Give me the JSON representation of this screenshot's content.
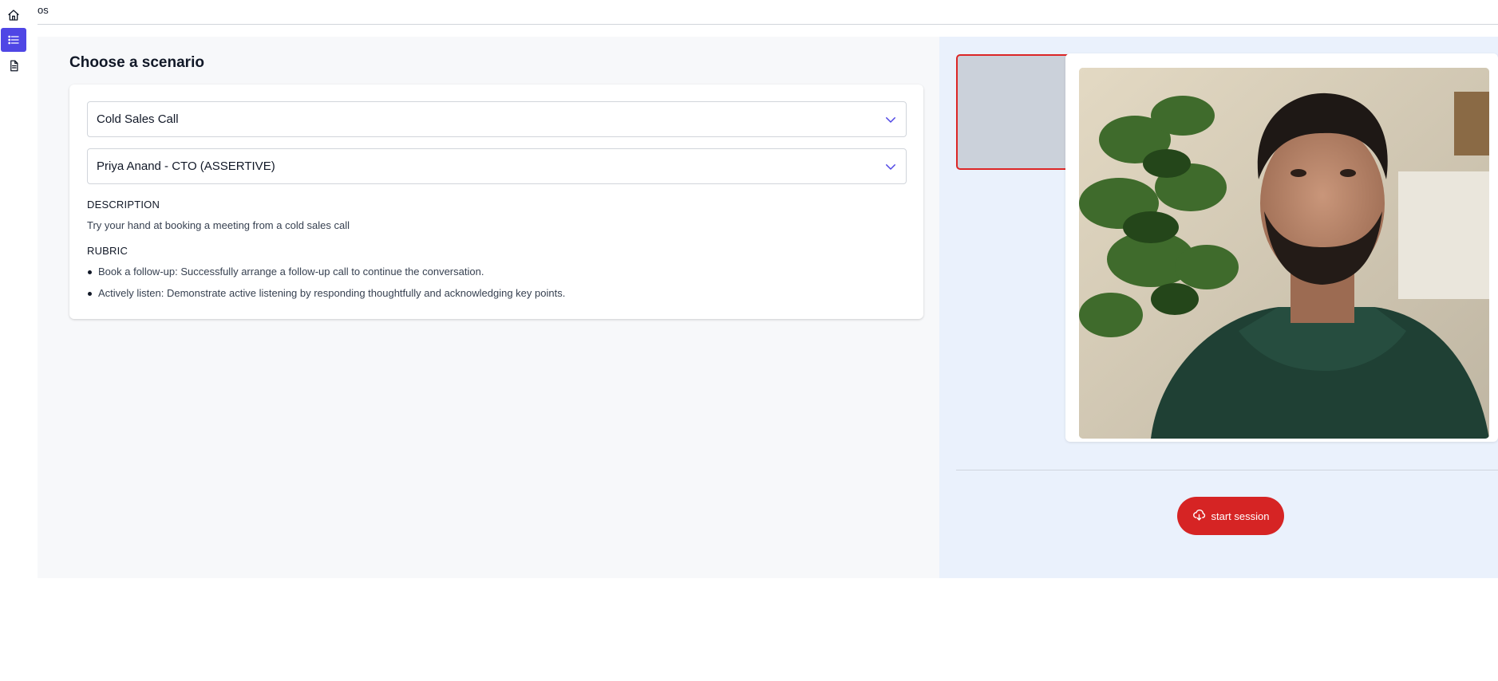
{
  "app": {
    "title": "os"
  },
  "nav": {
    "items": [
      {
        "icon": "home-icon",
        "active": false
      },
      {
        "icon": "list-icon",
        "active": true
      },
      {
        "icon": "document-icon",
        "active": false
      }
    ]
  },
  "scenario": {
    "heading": "Choose a scenario",
    "scenario_select": {
      "value": "Cold Sales Call"
    },
    "persona_select": {
      "value": "Priya Anand - CTO (ASSERTIVE)"
    },
    "description_label": "DESCRIPTION",
    "description_text": "Try your hand at booking a meeting from a cold sales call",
    "rubric_label": "RUBRIC",
    "rubric_items": [
      "Book a follow-up: Successfully arrange a follow-up call to continue the conversation.",
      "Actively listen: Demonstrate active listening by responding thoughtfully and acknowledging key points."
    ]
  },
  "session": {
    "start_label": "start session",
    "start_icon": "cloud-download-icon"
  },
  "colors": {
    "accent": "#4f46e5",
    "danger": "#d62424",
    "right_panel_bg": "#eaf1fc",
    "left_panel_bg": "#f7f8fa"
  }
}
